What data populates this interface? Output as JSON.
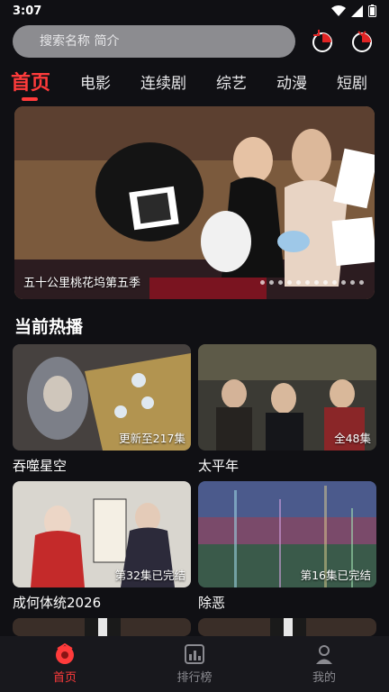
{
  "status_bar": {
    "time": "3:07"
  },
  "search": {
    "placeholder": "搜索名称 简介"
  },
  "tabs": [
    {
      "label": "首页",
      "active": true
    },
    {
      "label": "电影"
    },
    {
      "label": "连续剧"
    },
    {
      "label": "综艺"
    },
    {
      "label": "动漫"
    },
    {
      "label": "短剧"
    }
  ],
  "banner": {
    "caption": "五十公里桃花坞第五季",
    "dot_count": 12
  },
  "section": {
    "title": "当前热播"
  },
  "cards": [
    {
      "title": "吞噬星空",
      "episode": "更新至217集"
    },
    {
      "title": "太平年",
      "episode": "全48集"
    },
    {
      "title": "成何体统2026",
      "episode": "第32集已完结"
    },
    {
      "title": "除恶",
      "episode": "第16集已完结"
    }
  ],
  "bottom_nav": [
    {
      "label": "首页",
      "icon": "home-icon",
      "active": true
    },
    {
      "label": "排行榜",
      "icon": "ranking-icon"
    },
    {
      "label": "我的",
      "icon": "profile-icon"
    }
  ],
  "colors": {
    "accent": "#ff3b3b",
    "background": "#101014",
    "search_bg": "#8c8c90"
  }
}
